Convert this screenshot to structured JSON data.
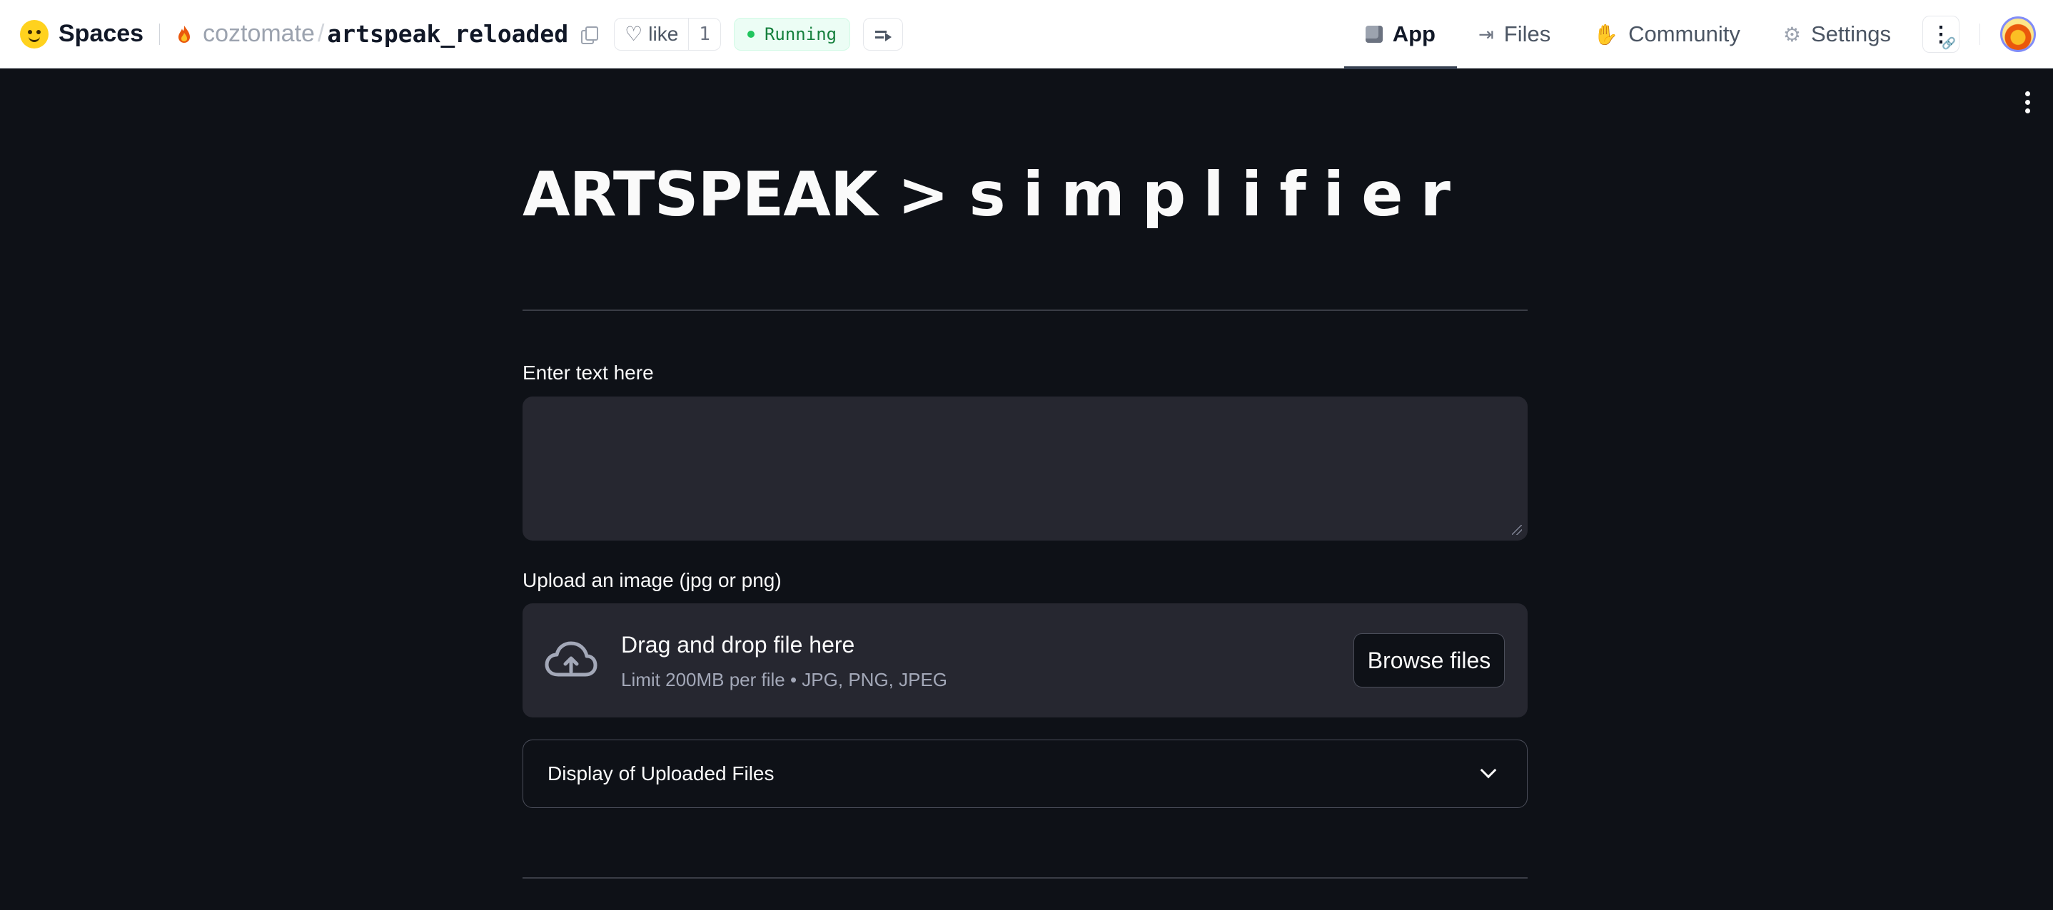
{
  "header": {
    "brand": "Spaces",
    "owner": "coztomate",
    "separator": "/",
    "repo": "artspeak_reloaded",
    "like_label": "like",
    "like_count": "1",
    "status": "Running",
    "status_color": "#22c55e"
  },
  "nav": {
    "tabs": [
      {
        "label": "App",
        "icon": "cube-icon",
        "active": true
      },
      {
        "label": "Files",
        "icon": "files-icon",
        "active": false
      },
      {
        "label": "Community",
        "icon": "community-icon",
        "active": false
      },
      {
        "label": "Settings",
        "icon": "gear-icon",
        "active": false
      }
    ],
    "more_icon": "kebab-icon"
  },
  "app": {
    "title_main": "ARTSPEAK >",
    "title_spaced": "simplifier",
    "text_label": "Enter text here",
    "text_value": "",
    "upload_label": "Upload an image (jpg or png)",
    "dropzone_title": "Drag and drop file here",
    "dropzone_limit": "Limit 200MB per file • JPG, PNG, JPEG",
    "browse_label": "Browse files",
    "expander_label": "Display of Uploaded Files",
    "background": "#0e1117",
    "widget_bg": "#262730"
  }
}
